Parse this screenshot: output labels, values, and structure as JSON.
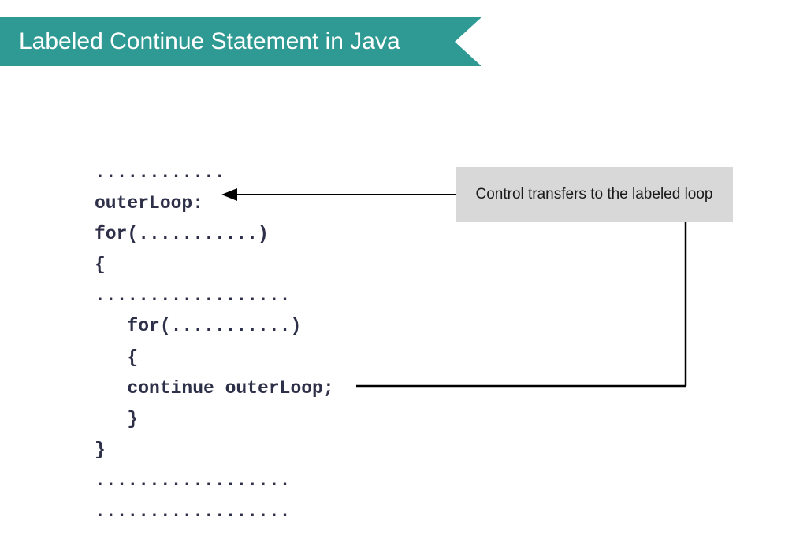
{
  "banner": {
    "title": "Labeled Continue Statement in Java"
  },
  "code": {
    "lines": [
      "............",
      "outerLoop:",
      "for(...........)",
      "{",
      "..................",
      "   for(...........)",
      "   {",
      "   continue outerLoop;",
      "   }",
      "}",
      "..................",
      ".................."
    ]
  },
  "annotation": {
    "text": "Control transfers to the labeled loop"
  },
  "colors": {
    "banner_bg": "#2f9a93",
    "annotation_bg": "#d8d8d8",
    "code_color": "#2d3048"
  }
}
